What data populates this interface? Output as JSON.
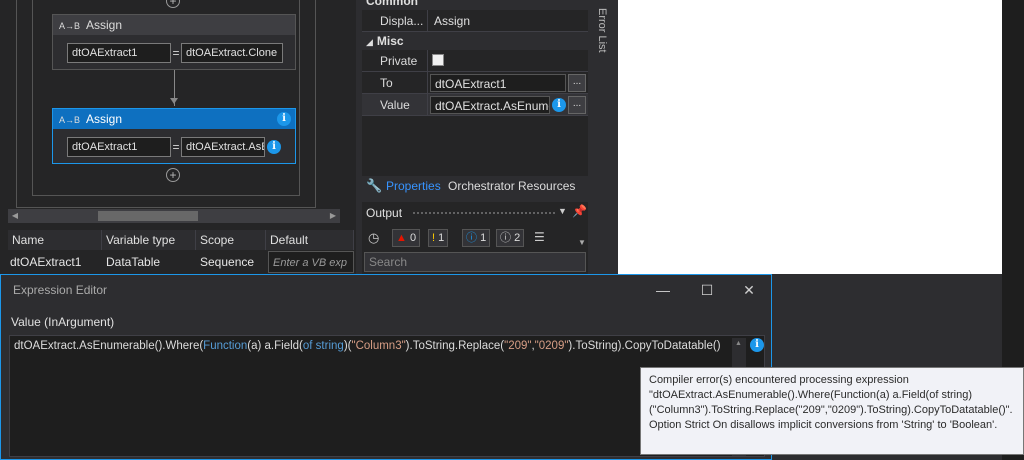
{
  "designer": {
    "assign1": {
      "title": "Assign",
      "to": "dtOAExtract1",
      "value": "dtOAExtract.Clone"
    },
    "assign2": {
      "title": "Assign",
      "to": "dtOAExtract1",
      "value": "dtOAExtract.AsE"
    },
    "icon_text": "A→B",
    "plus_glyph": "+",
    "equals": "="
  },
  "variables": {
    "headers": [
      "Name",
      "Variable type",
      "Scope",
      "Default"
    ],
    "row": {
      "name": "dtOAExtract1",
      "type": "DataTable",
      "scope": "Sequence",
      "default_placeholder": "Enter a VB exp"
    }
  },
  "properties": {
    "common_label": "Common",
    "display_label": "Displa...",
    "display_value": "Assign",
    "misc_label": "Misc",
    "private_label": "Private",
    "to_label": "To",
    "to_value": "dtOAExtract1",
    "value_label": "Value",
    "value_value": "dtOAExtract.AsEnumer",
    "ellipsis": "...",
    "tabs": [
      "Properties",
      "Orchestrator Resources"
    ]
  },
  "output": {
    "title": "Output",
    "counts": {
      "errors": "0",
      "warnings": "1",
      "info": "1",
      "trace": "2"
    },
    "search_placeholder": "Search"
  },
  "error_list_label": "Error List",
  "expression_editor": {
    "title": "Expression Editor",
    "label": "Value (InArgument)",
    "code_parts": [
      "dtOAExtract.AsEnumerable().Where(",
      "Function",
      "(a) a.Field(",
      "of string",
      ")(",
      "\"Column3\"",
      ").ToString.Replace(",
      "\"209\"",
      ",",
      "\"0209\"",
      ").ToString).CopyToDatatable()"
    ],
    "tooltip_lines": [
      "Compiler error(s) encountered processing expression",
      "\"dtOAExtract.AsEnumerable().Where(Function(a) a.Field(of string)",
      "(\"Column3\").ToString.Replace(\"209\",\"0209\").ToString).CopyToDatatable()\".",
      "Option Strict On disallows implicit conversions from 'String' to 'Boolean'."
    ]
  },
  "colors": {
    "accent": "#1c97ea",
    "background": "#2d2d30",
    "selected_header": "#0e70c0"
  }
}
